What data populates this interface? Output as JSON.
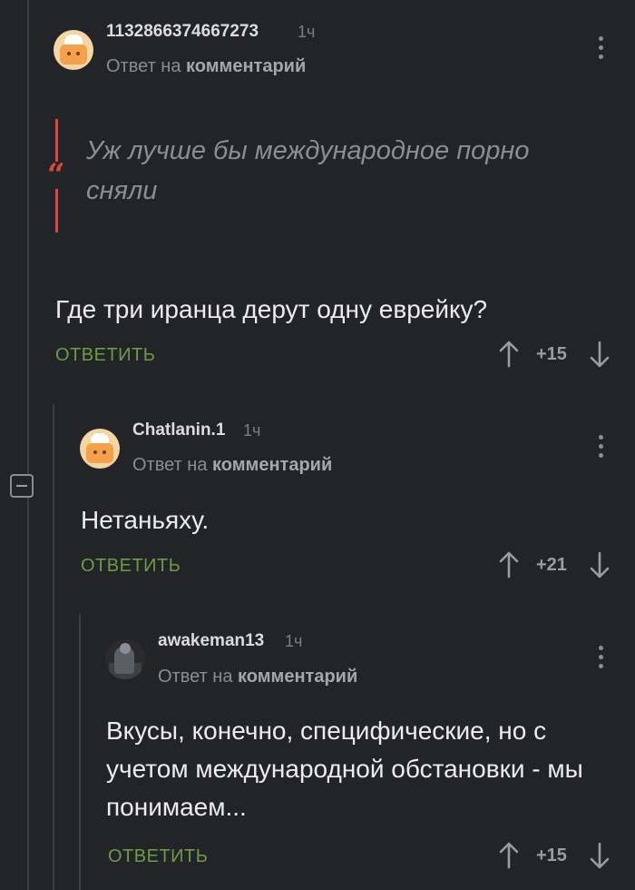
{
  "comments": [
    {
      "username": "1132866374667273",
      "time": "1ч",
      "reply_prefix": "Ответ на",
      "reply_target": "комментарий",
      "quote": "Уж лучше бы международное порно сняли",
      "text": "Где три иранца дерут одну еврейку?",
      "reply_label": "ОТВЕТИТЬ",
      "score": "+15"
    },
    {
      "username": "Chatlanin.1",
      "time": "1ч",
      "reply_prefix": "Ответ на",
      "reply_target": "комментарий",
      "text": "Нетаньяху.",
      "reply_label": "ОТВЕТИТЬ",
      "score": "+21"
    },
    {
      "username": "awakeman13",
      "time": "1ч",
      "reply_prefix": "Ответ на",
      "reply_target": "комментарий",
      "text": "Вкусы, конечно, специфические, но с учетом международной обстановки - мы понимаем...",
      "reply_label": "ОТВЕТИТЬ",
      "score": "+15"
    }
  ],
  "colors": {
    "background": "#222427",
    "accent_reply": "#6c9c44",
    "quote_bar": "#e0463f"
  },
  "icons": [
    "kebab-menu-icon",
    "arrow-up-icon",
    "arrow-down-icon",
    "quote-icon",
    "collapse-icon"
  ]
}
